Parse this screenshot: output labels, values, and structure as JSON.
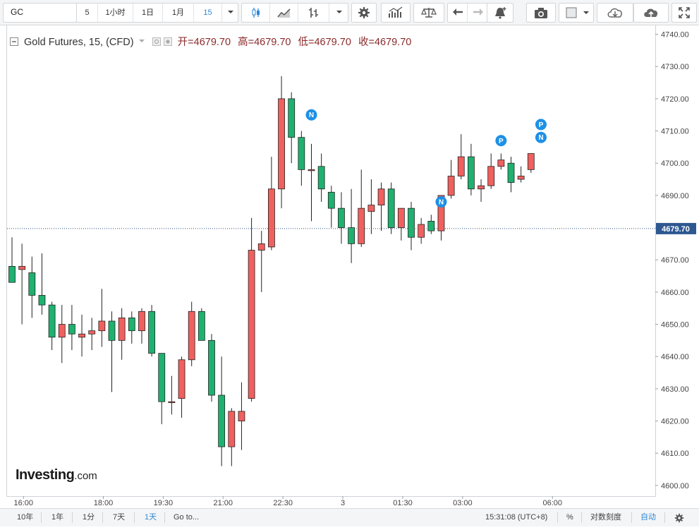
{
  "toolbar": {
    "symbol": "GC",
    "interval_value": "5",
    "buttons": [
      "1小时",
      "1日",
      "1月"
    ],
    "interval_selected": "15"
  },
  "legend": {
    "title": "Gold Futures, 15, (CFD)",
    "open_label": "开=",
    "open": "4679.70",
    "high_label": "高=",
    "high": "4679.70",
    "low_label": "低=",
    "low": "4679.70",
    "close_label": "收=",
    "close": "4679.70"
  },
  "logo": {
    "brand": "Investing",
    "suffix": ".com"
  },
  "bottom_bar": {
    "ranges": [
      "10年",
      "1年",
      "1分",
      "7天",
      "1天"
    ],
    "active_range": "1天",
    "goto": "Go to...",
    "clock": "15:31:08 (UTC+8)",
    "percent": "%",
    "log_scale": "对数刻度",
    "auto": "自动"
  },
  "colors": {
    "up": "#f0605e",
    "down": "#1fb16f",
    "accent": "#2e88d8",
    "marker": "#1e90e6"
  },
  "chart_data": {
    "type": "candlestick",
    "title": "Gold Futures, 15, (CFD)",
    "y_ticks": [
      4600,
      4610,
      4620,
      4630,
      4640,
      4650,
      4660,
      4670,
      4680,
      4690,
      4700,
      4710,
      4720,
      4730,
      4740
    ],
    "ylim": [
      4598,
      4741
    ],
    "last_price": 4679.7,
    "last_price_label": "4679.70",
    "x_ticks": [
      {
        "label": "16:00",
        "i": 1.15
      },
      {
        "label": "18:00",
        "i": 9.15
      },
      {
        "label": "19:30",
        "i": 15.15
      },
      {
        "label": "21:00",
        "i": 21.15
      },
      {
        "label": "22:30",
        "i": 27.15
      },
      {
        "label": "3",
        "i": 33.15
      },
      {
        "label": "01:30",
        "i": 39.15
      },
      {
        "label": "03:00",
        "i": 45.15
      },
      {
        "label": "06:00",
        "i": 54.15
      }
    ],
    "candles": [
      {
        "o": 4668,
        "h": 4677,
        "l": 4664,
        "c": 4663
      },
      {
        "o": 4667,
        "h": 4675,
        "l": 4650,
        "c": 4668
      },
      {
        "o": 4666,
        "h": 4671,
        "l": 4652,
        "c": 4659
      },
      {
        "o": 4659,
        "h": 4672,
        "l": 4653,
        "c": 4656
      },
      {
        "o": 4656,
        "h": 4657,
        "l": 4642,
        "c": 4646
      },
      {
        "o": 4646,
        "h": 4656,
        "l": 4638,
        "c": 4650
      },
      {
        "o": 4650,
        "h": 4656,
        "l": 4642,
        "c": 4647
      },
      {
        "o": 4646,
        "h": 4653,
        "l": 4640,
        "c": 4647
      },
      {
        "o": 4647,
        "h": 4652,
        "l": 4642,
        "c": 4648
      },
      {
        "o": 4648,
        "h": 4661,
        "l": 4643,
        "c": 4651
      },
      {
        "o": 4651,
        "h": 4654,
        "l": 4629,
        "c": 4645
      },
      {
        "o": 4645,
        "h": 4655,
        "l": 4639,
        "c": 4652
      },
      {
        "o": 4652,
        "h": 4654,
        "l": 4644,
        "c": 4648
      },
      {
        "o": 4648,
        "h": 4655,
        "l": 4644,
        "c": 4654
      },
      {
        "o": 4654,
        "h": 4656,
        "l": 4640,
        "c": 4641
      },
      {
        "o": 4641,
        "h": 4638,
        "l": 4619,
        "c": 4626
      },
      {
        "o": 4626,
        "h": 4634,
        "l": 4622,
        "c": 4626
      },
      {
        "o": 4627,
        "h": 4640,
        "l": 4621,
        "c": 4639
      },
      {
        "o": 4639,
        "h": 4657,
        "l": 4637,
        "c": 4654
      },
      {
        "o": 4654,
        "h": 4655,
        "l": 4645,
        "c": 4645
      },
      {
        "o": 4645,
        "h": 4647,
        "l": 4626,
        "c": 4628
      },
      {
        "o": 4628,
        "h": 4640,
        "l": 4606,
        "c": 4612
      },
      {
        "o": 4612,
        "h": 4624,
        "l": 4606,
        "c": 4623
      },
      {
        "o": 4620,
        "h": 4632,
        "l": 4611,
        "c": 4623
      },
      {
        "o": 4627,
        "h": 4683,
        "l": 4626,
        "c": 4673
      },
      {
        "o": 4673,
        "h": 4679,
        "l": 4660,
        "c": 4675
      },
      {
        "o": 4674,
        "h": 4702,
        "l": 4673,
        "c": 4692
      },
      {
        "o": 4692,
        "h": 4727,
        "l": 4686,
        "c": 4720
      },
      {
        "o": 4720,
        "h": 4722,
        "l": 4700,
        "c": 4708
      },
      {
        "o": 4708,
        "h": 4710,
        "l": 4693,
        "c": 4698
      },
      {
        "o": 4698,
        "h": 4706,
        "l": 4682,
        "c": 4698
      },
      {
        "o": 4699,
        "h": 4703,
        "l": 4688,
        "c": 4692
      },
      {
        "o": 4691,
        "h": 4693,
        "l": 4680,
        "c": 4686
      },
      {
        "o": 4686,
        "h": 4691,
        "l": 4675,
        "c": 4680
      },
      {
        "o": 4680,
        "h": 4692,
        "l": 4669,
        "c": 4675
      },
      {
        "o": 4675,
        "h": 4698,
        "l": 4674,
        "c": 4686
      },
      {
        "o": 4685,
        "h": 4695,
        "l": 4678,
        "c": 4687
      },
      {
        "o": 4687,
        "h": 4694,
        "l": 4679,
        "c": 4692
      },
      {
        "o": 4692,
        "h": 4694,
        "l": 4678,
        "c": 4680
      },
      {
        "o": 4680,
        "h": 4686,
        "l": 4676,
        "c": 4686
      },
      {
        "o": 4686,
        "h": 4688,
        "l": 4673,
        "c": 4677
      },
      {
        "o": 4677,
        "h": 4683,
        "l": 4675,
        "c": 4681
      },
      {
        "o": 4682,
        "h": 4684,
        "l": 4678,
        "c": 4679
      },
      {
        "o": 4679,
        "h": 4690,
        "l": 4676,
        "c": 4690
      },
      {
        "o": 4690,
        "h": 4701,
        "l": 4689,
        "c": 4696
      },
      {
        "o": 4696,
        "h": 4709,
        "l": 4695,
        "c": 4702
      },
      {
        "o": 4702,
        "h": 4706,
        "l": 4690,
        "c": 4692
      },
      {
        "o": 4692,
        "h": 4695,
        "l": 4688,
        "c": 4693
      },
      {
        "o": 4693,
        "h": 4703,
        "l": 4692,
        "c": 4699
      },
      {
        "o": 4699,
        "h": 4703,
        "l": 4698,
        "c": 4701
      },
      {
        "o": 4700,
        "h": 4702,
        "l": 4691,
        "c": 4694
      },
      {
        "o": 4695,
        "h": 4699,
        "l": 4694,
        "c": 4696
      },
      {
        "o": 4698,
        "h": 4703,
        "l": 4697,
        "c": 4703
      }
    ],
    "markers": [
      {
        "i": 30,
        "price": 4715,
        "label": "N"
      },
      {
        "i": 43,
        "price": 4688,
        "label": "N"
      },
      {
        "i": 49,
        "price": 4707,
        "label": "P"
      },
      {
        "i": 53,
        "price": 4712,
        "label": "P"
      },
      {
        "i": 53,
        "price": 4708,
        "label": "N"
      }
    ]
  }
}
